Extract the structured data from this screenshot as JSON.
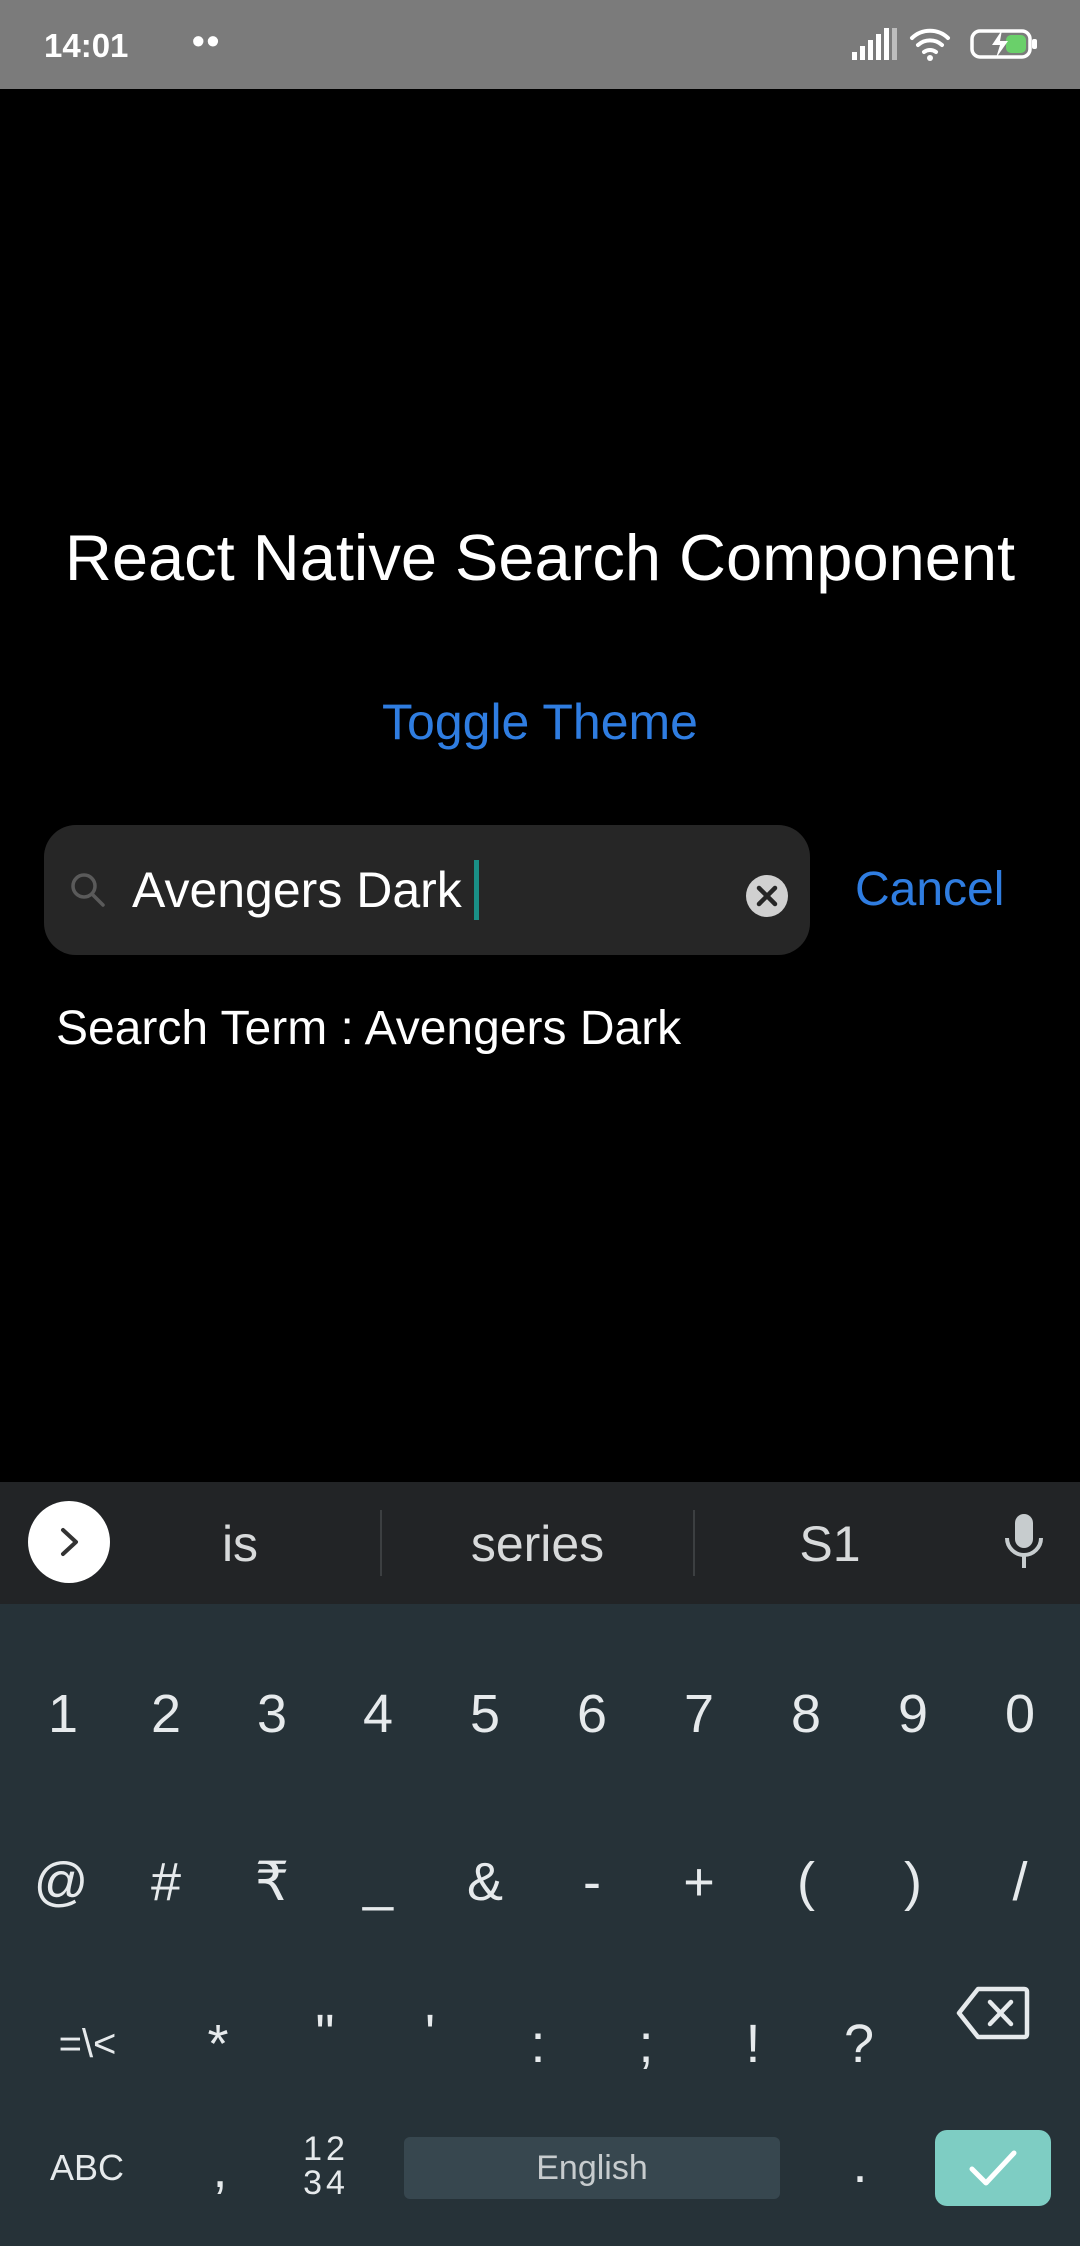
{
  "status_bar": {
    "time": "14:01",
    "dots": "••"
  },
  "app": {
    "title": "React Native Search Component",
    "toggle_theme_label": "Toggle Theme",
    "search": {
      "value": "Avengers Dark",
      "cancel_label": "Cancel"
    },
    "search_term_text": "Search Term : Avengers Dark"
  },
  "keyboard": {
    "suggestions": [
      "is",
      "series",
      "S1"
    ],
    "row1": [
      "1",
      "2",
      "3",
      "4",
      "5",
      "6",
      "7",
      "8",
      "9",
      "0"
    ],
    "row2": [
      "@",
      "#",
      "₹",
      "_",
      "&",
      "-",
      "+",
      "(",
      ")",
      "/"
    ],
    "row3": [
      "=\\<",
      "*",
      "\"",
      "'",
      ":",
      ";",
      "!",
      "?"
    ],
    "abc_label": "ABC",
    "comma": ",",
    "numsym_top": "12",
    "numsym_bottom": "34",
    "space_label": "English",
    "period": "."
  },
  "colors": {
    "accent": "#2f7de1",
    "caret": "#1a8f86",
    "enter_key": "#7ecdc3",
    "keyboard_bg": "#263238",
    "status_bar_bg": "#7b7b7b"
  }
}
